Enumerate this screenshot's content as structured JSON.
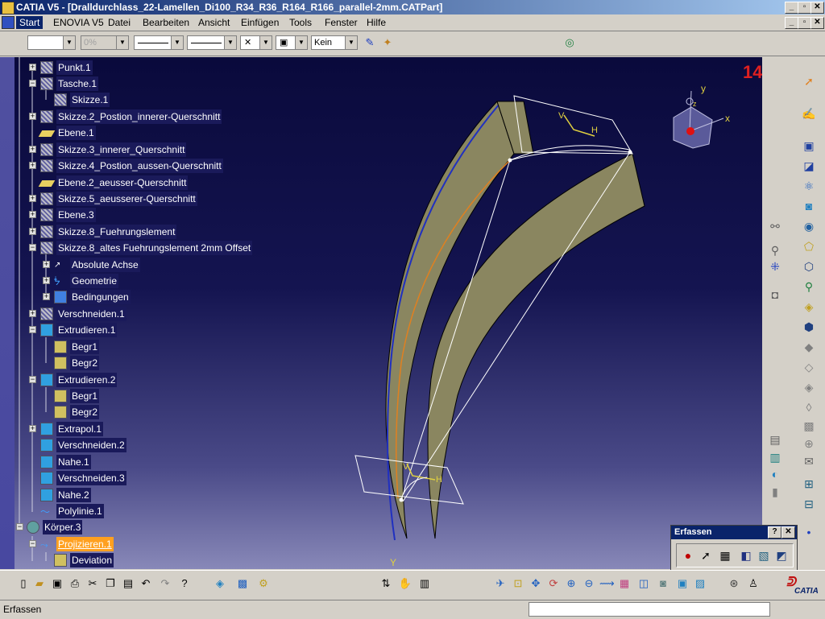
{
  "window": {
    "title": "CATIA V5 - [Dralldurchlass_22-Lamellen_Di100_R34_R36_R164_R166_parallel-2mm.CATPart]",
    "controls": [
      "_",
      "▫",
      "✕"
    ]
  },
  "menubar": {
    "items": [
      "Start",
      "ENOVIA V5",
      "Datei",
      "Bearbeiten",
      "Ansicht",
      "Einfügen",
      "Tools",
      "Fenster",
      "Hilfe"
    ]
  },
  "toolbar": {
    "transparency_value": "0%",
    "layer_value": "Kein"
  },
  "viewport": {
    "page_number": "14",
    "compass_axes": {
      "x": "x",
      "y": "y",
      "z": "z"
    },
    "sketch_labels": {
      "v1": "V",
      "h1": "H",
      "v2": "V",
      "h2": "H"
    },
    "origin_label": "Y"
  },
  "tree": {
    "items": [
      {
        "label": "Punkt.1",
        "icon": "sketch-icon",
        "selected": false
      },
      {
        "label": "Tasche.1",
        "icon": "pocket-icon",
        "selected": false
      },
      {
        "label": "Skizze.1",
        "icon": "sketch-icon",
        "selected": false
      },
      {
        "label": "Skizze.2_Postion_innerer-Querschnitt",
        "icon": "sketch-icon",
        "selected": false
      },
      {
        "label": "Ebene.1",
        "icon": "plane-icon",
        "selected": false
      },
      {
        "label": "Skizze.3_innerer_Querschnitt",
        "icon": "sketch-icon",
        "selected": false
      },
      {
        "label": "Skizze.4_Postion_aussen-Querschnitt",
        "icon": "sketch-icon",
        "selected": false
      },
      {
        "label": "Ebene.2_aeusser-Querschnitt",
        "icon": "plane-icon",
        "selected": false
      },
      {
        "label": "Skizze.5_aeusserer-Querschnitt",
        "icon": "sketch-icon",
        "selected": false
      },
      {
        "label": "Ebene.3",
        "icon": "sketch-icon",
        "selected": false
      },
      {
        "label": "Skizze.8_Fuehrungslement",
        "icon": "sketch-icon",
        "selected": false
      },
      {
        "label": "Skizze.8_altes Fuehrungslement 2mm Offset",
        "icon": "sketch-icon",
        "selected": false
      },
      {
        "label": "Absolute Achse",
        "icon": "axis-icon",
        "selected": false
      },
      {
        "label": "Geometrie",
        "icon": "geometry-icon",
        "selected": false
      },
      {
        "label": "Bedingungen",
        "icon": "constraints-icon",
        "selected": false
      },
      {
        "label": "Verschneiden.1",
        "icon": "sketch-icon",
        "selected": false
      },
      {
        "label": "Extrudieren.1",
        "icon": "extrude-icon",
        "selected": false
      },
      {
        "label": "Begr1",
        "icon": "limit-icon",
        "selected": false
      },
      {
        "label": "Begr2",
        "icon": "limit-icon",
        "selected": false
      },
      {
        "label": "Extrudieren.2",
        "icon": "extrude-icon",
        "selected": false
      },
      {
        "label": "Begr1",
        "icon": "limit-icon",
        "selected": false
      },
      {
        "label": "Begr2",
        "icon": "limit-icon",
        "selected": false
      },
      {
        "label": "Extrapol.1",
        "icon": "extrapolate-icon",
        "selected": false
      },
      {
        "label": "Verschneiden.2",
        "icon": "intersect-icon",
        "selected": false
      },
      {
        "label": "Nahe.1",
        "icon": "near-icon",
        "selected": false
      },
      {
        "label": "Verschneiden.3",
        "icon": "intersect-icon",
        "selected": false
      },
      {
        "label": "Nahe.2",
        "icon": "near-icon",
        "selected": false
      },
      {
        "label": "Polylinie.1",
        "icon": "polyline-icon",
        "selected": false
      },
      {
        "label": "Körper.3",
        "icon": "body-icon",
        "selected": false
      },
      {
        "label": "Projizieren.1",
        "icon": "project-icon",
        "selected": true
      },
      {
        "label": "Deviation",
        "icon": "limit-icon",
        "selected": false
      }
    ]
  },
  "palette": {
    "title": "Erfassen",
    "help": "?",
    "close": "✕"
  },
  "statusbar": {
    "text": "Erfassen"
  },
  "colors": {
    "titlebar_start": "#0a246a",
    "selection_orange": "#ffa020",
    "surface_khaki": "#8a8660",
    "page_number_red": "#e02020"
  }
}
